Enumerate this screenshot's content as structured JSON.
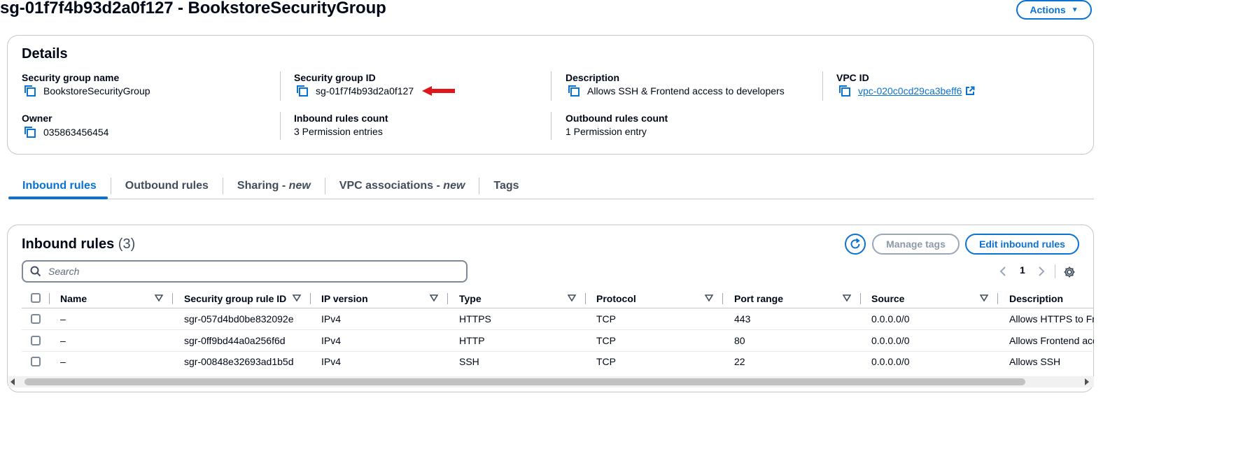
{
  "header": {
    "title": "sg-01f7f4b93d2a0f127 - BookstoreSecurityGroup",
    "actions_label": "Actions"
  },
  "details": {
    "title": "Details",
    "security_group_name_label": "Security group name",
    "security_group_name": "BookstoreSecurityGroup",
    "security_group_id_label": "Security group ID",
    "security_group_id": "sg-01f7f4b93d2a0f127",
    "description_label": "Description",
    "description": "Allows SSH & Frontend access to developers",
    "vpc_id_label": "VPC ID",
    "vpc_id": "vpc-020c0cd29ca3beff6",
    "owner_label": "Owner",
    "owner": "035863456454",
    "inbound_count_label": "Inbound rules count",
    "inbound_count": "3 Permission entries",
    "outbound_count_label": "Outbound rules count",
    "outbound_count": "1 Permission entry"
  },
  "tabs": [
    {
      "label": "Inbound rules",
      "suffix": ""
    },
    {
      "label": "Outbound rules",
      "suffix": ""
    },
    {
      "label": "Sharing - ",
      "suffix": "new"
    },
    {
      "label": "VPC associations - ",
      "suffix": "new"
    },
    {
      "label": "Tags",
      "suffix": ""
    }
  ],
  "inbound_rules": {
    "title": "Inbound rules",
    "count": "(3)",
    "manage_tags_label": "Manage tags",
    "edit_label": "Edit inbound rules",
    "search_placeholder": "Search",
    "page_number": "1",
    "columns": [
      "Name",
      "Security group rule ID",
      "IP version",
      "Type",
      "Protocol",
      "Port range",
      "Source",
      "Description"
    ],
    "rows": [
      {
        "name": "–",
        "rule_id": "sgr-057d4bd0be832092e",
        "ip_version": "IPv4",
        "type": "HTTPS",
        "protocol": "TCP",
        "port_range": "443",
        "source": "0.0.0.0/0",
        "description": "Allows HTTPS to Fr"
      },
      {
        "name": "–",
        "rule_id": "sgr-0ff9bd44a0a256f6d",
        "ip_version": "IPv4",
        "type": "HTTP",
        "protocol": "TCP",
        "port_range": "80",
        "source": "0.0.0.0/0",
        "description": "Allows Frontend acc"
      },
      {
        "name": "–",
        "rule_id": "sgr-00848e32693ad1b5d",
        "ip_version": "IPv4",
        "type": "SSH",
        "protocol": "TCP",
        "port_range": "22",
        "source": "0.0.0.0/0",
        "description": "Allows SSH"
      }
    ]
  },
  "colors": {
    "accent": "#0972d3",
    "text": "#000716",
    "annotation_arrow": "#e0161b"
  }
}
